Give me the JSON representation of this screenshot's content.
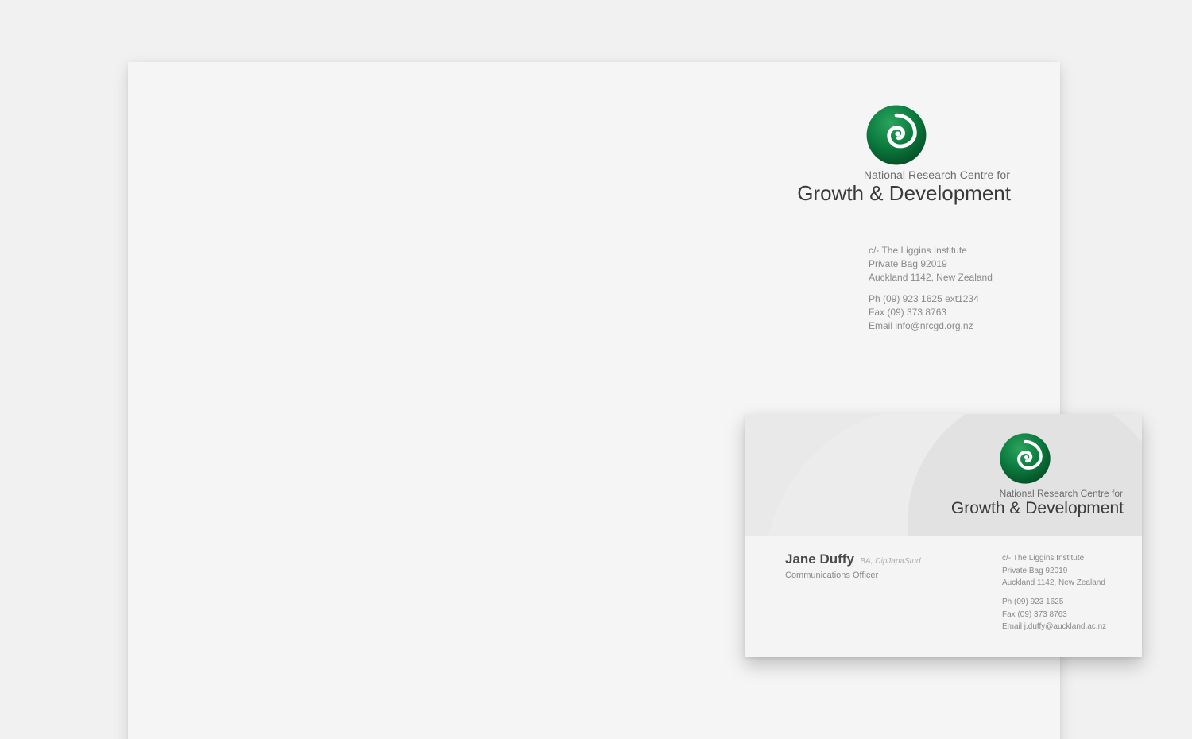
{
  "brand": {
    "org_line_small": "National Research Centre for",
    "org_line_big": "Growth & Development",
    "logo_icon": "spiral-koru-icon",
    "logo_color": "#0b7a3e",
    "logo_color_dark": "#055a2a"
  },
  "letterhead": {
    "address": [
      "c/- The Liggins Institute",
      "Private Bag 92019",
      "Auckland 1142, New Zealand"
    ],
    "contact": [
      "Ph (09) 923 1625 ext1234",
      "Fax (09) 373 8763",
      "Email info@nrcgd.org.nz"
    ]
  },
  "business_card": {
    "name": "Jane Duffy",
    "credentials": "BA, DipJapaStud",
    "role": "Communications Officer",
    "address": [
      "c/- The Liggins Institute",
      "Private Bag 92019",
      "Auckland 1142, New Zealand"
    ],
    "contact": [
      "Ph (09) 923 1625",
      "Fax (09) 373 8763",
      "Email j.duffy@auckland.ac.nz"
    ]
  }
}
